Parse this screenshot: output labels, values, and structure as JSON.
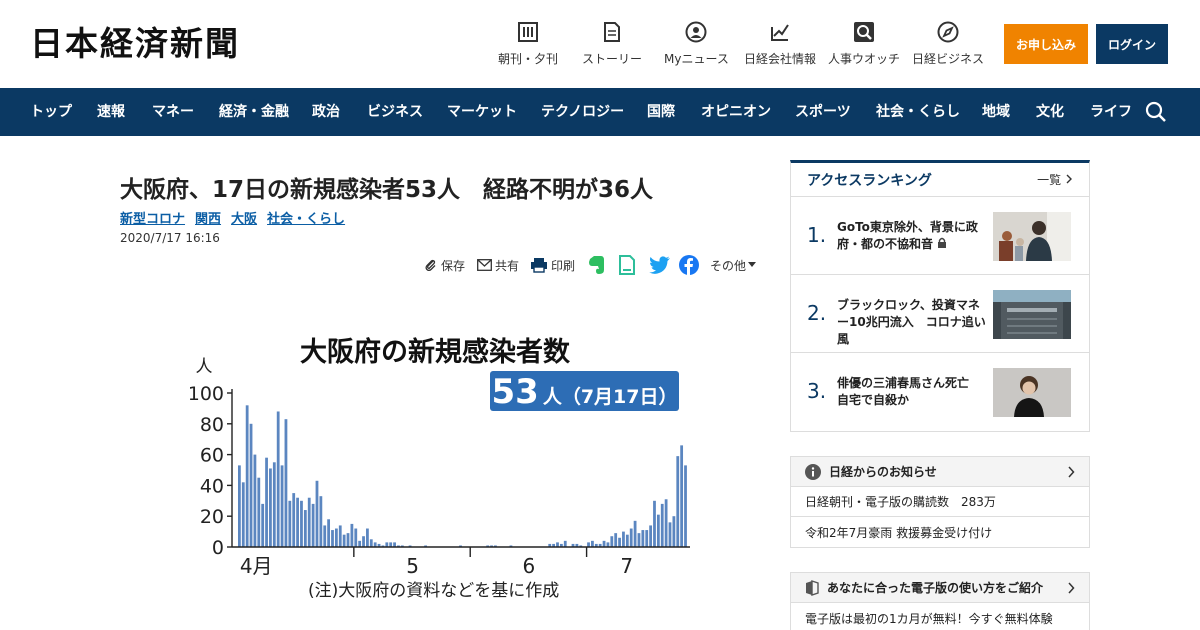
{
  "header": {
    "logo": "日本経済新聞",
    "utils": [
      {
        "label": "朝刊・夕刊",
        "icon": "newspaper-icon"
      },
      {
        "label": "ストーリー",
        "icon": "document-icon"
      },
      {
        "label": "Myニュース",
        "icon": "user-icon"
      },
      {
        "label": "日経会社情報",
        "icon": "stock-chart-icon"
      },
      {
        "label": "人事ウオッチ",
        "icon": "search-person-icon"
      },
      {
        "label": "日経ビジネス",
        "icon": "compass-icon"
      }
    ],
    "apply_label": "お申し込み",
    "login_label": "ログイン"
  },
  "nav": {
    "items": [
      "トップ",
      "速報",
      "マネー",
      "経済・金融",
      "政治",
      "ビジネス",
      "マーケット",
      "テクノロジー",
      "国際",
      "オピニオン",
      "スポーツ",
      "社会・くらし",
      "地域",
      "文化",
      "ライフ"
    ]
  },
  "article": {
    "headline": "大阪府、17日の新規感染者53人　経路不明が36人",
    "tags": [
      "新型コロナ",
      "関西",
      "大阪",
      "社会・くらし"
    ],
    "date": "2020/7/17 16:16",
    "tools": {
      "save": "保存",
      "share": "共有",
      "print": "印刷",
      "other": "その他"
    }
  },
  "chart_data": {
    "type": "bar",
    "title": "大阪府の新規感染者数",
    "badge_number": "53",
    "badge_text": "人（7月17日）",
    "ylabel": "人",
    "ylim": [
      0,
      100
    ],
    "yticks": [
      0,
      20,
      40,
      60,
      80,
      100
    ],
    "xticks": [
      "4月",
      "5",
      "6",
      "7"
    ],
    "note": "(注)大阪府の資料などを基に作成",
    "color": "#5b86c0",
    "values": [
      53,
      42,
      92,
      80,
      60,
      45,
      28,
      58,
      51,
      55,
      88,
      53,
      83,
      30,
      35,
      32,
      30,
      24,
      32,
      28,
      43,
      33,
      14,
      18,
      11,
      12,
      14,
      8,
      9,
      15,
      12,
      4,
      7,
      12,
      5,
      3,
      2,
      1,
      3,
      3,
      3,
      1,
      1,
      0,
      1,
      0,
      0,
      0,
      1,
      0,
      0,
      0,
      0,
      0,
      0,
      0,
      0,
      1,
      0,
      0,
      0,
      0,
      0,
      0,
      1,
      1,
      1,
      0,
      0,
      0,
      1,
      0,
      0,
      0,
      0,
      0,
      0,
      0,
      0,
      0,
      2,
      2,
      3,
      2,
      4,
      0,
      2,
      2,
      1,
      0,
      3,
      4,
      2,
      2,
      4,
      3,
      7,
      9,
      6,
      10,
      8,
      12,
      17,
      9,
      11,
      11,
      14,
      30,
      21,
      28,
      31,
      16,
      20,
      59,
      66,
      53
    ]
  },
  "sidebar": {
    "ranking_title": "アクセスランキング",
    "ranking_more": "一覧",
    "ranking": [
      {
        "num": "1.",
        "title": "GoTo東京除外、背景に政府・都の不協和音"
      },
      {
        "num": "2.",
        "title": "ブラックロック、投資マネー10兆円流入　コロナ追い風"
      },
      {
        "num": "3.",
        "title": "俳優の三浦春馬さん死亡　自宅で自殺か"
      }
    ],
    "notice_title": "日経からのお知らせ",
    "notices": [
      "日経朝刊・電子版の購読数　283万",
      "令和2年7月豪雨 救援募金受け付け"
    ],
    "guide_title": "あなたに合った電子版の使い方をご紹介",
    "guide_rows": [
      "電子版は最初の1カ月が無料！今すぐ無料体験"
    ]
  }
}
